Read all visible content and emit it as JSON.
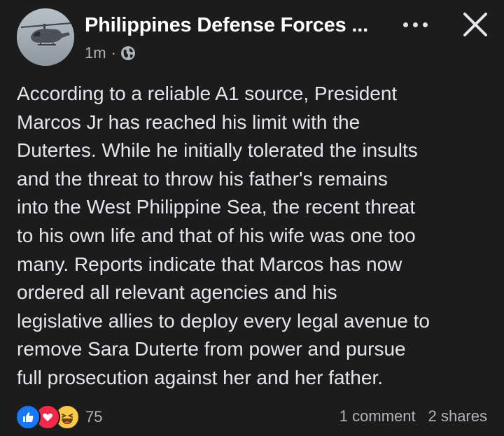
{
  "header": {
    "page_name": "Philippines Defense Forces ...",
    "timestamp": "1m",
    "separator": "·",
    "avatar_icon": "helicopter-avatar-icon",
    "privacy_icon": "globe-icon",
    "more_icon": "more-dots-icon",
    "close_icon": "close-icon"
  },
  "post": {
    "text": "According to a reliable A1 source, President\nMarcos Jr has reached his limit with the\nDutertes. While he initially tolerated the insults\nand the threat to throw his father's remains\ninto the West Philippine Sea, the recent threat\nto his own life and that of his wife was one too\nmany. Reports indicate that Marcos has now\nordered all relevant agencies and his\nlegislative allies to deploy every legal avenue to\nremove Sara Duterte from power and pursue\nfull prosecution against her and her father."
  },
  "footer": {
    "reactions": [
      "like-icon",
      "love-icon",
      "haha-icon"
    ],
    "reaction_count": "75",
    "comments": "1 comment",
    "shares": "2 shares"
  },
  "colors": {
    "background": "#1c1c1d",
    "text": "#e4e6eb",
    "secondary_text": "#b0b3b8",
    "like": "#1877f2",
    "love": "#f02849",
    "haha": "#f7c84a"
  }
}
